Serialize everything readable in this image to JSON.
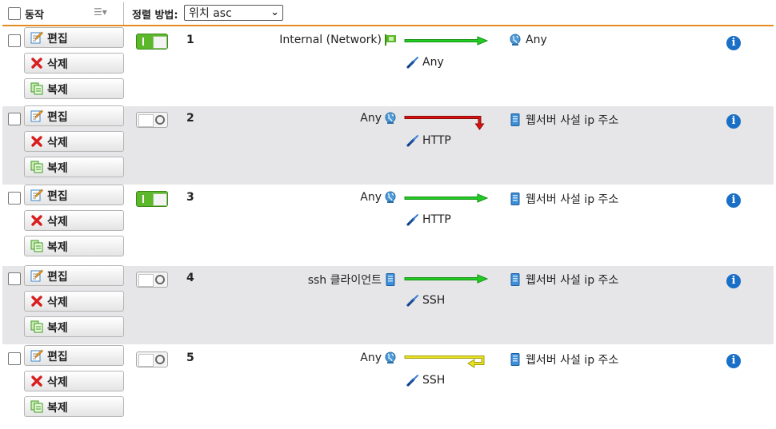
{
  "header": {
    "action_label": "동작",
    "sort_label": "정렬 방법:",
    "sort_value": "위치 asc"
  },
  "buttons": {
    "edit": "편집",
    "delete": "삭제",
    "copy": "복제"
  },
  "rules": [
    {
      "num": "1",
      "enabled": true,
      "source": "Internal (Network)",
      "source_icon": "network-flag-icon",
      "service": "Any",
      "destination": "Any",
      "dest_icon": "globe-icon",
      "action": "allow",
      "arrow_color": "#22cc22"
    },
    {
      "num": "2",
      "enabled": false,
      "source": "Any",
      "source_icon": "globe-icon",
      "service": "HTTP",
      "destination": "웹서버 사설 ip 주소",
      "dest_icon": "host-icon",
      "action": "drop",
      "arrow_color": "#dd1111"
    },
    {
      "num": "3",
      "enabled": true,
      "source": "Any",
      "source_icon": "globe-icon",
      "service": "HTTP",
      "destination": "웹서버 사설 ip 주소",
      "dest_icon": "host-icon",
      "action": "allow",
      "arrow_color": "#22cc22"
    },
    {
      "num": "4",
      "enabled": false,
      "source": "ssh 클라이언트",
      "source_icon": "host-icon",
      "service": "SSH",
      "destination": "웹서버 사설 ip 주소",
      "dest_icon": "host-icon",
      "action": "allow",
      "arrow_color": "#22cc22"
    },
    {
      "num": "5",
      "enabled": false,
      "source": "Any",
      "source_icon": "globe-icon",
      "service": "SSH",
      "destination": "웹서버 사설 ip 주소",
      "dest_icon": "host-icon",
      "action": "reject",
      "arrow_color": "#e8e020"
    }
  ]
}
